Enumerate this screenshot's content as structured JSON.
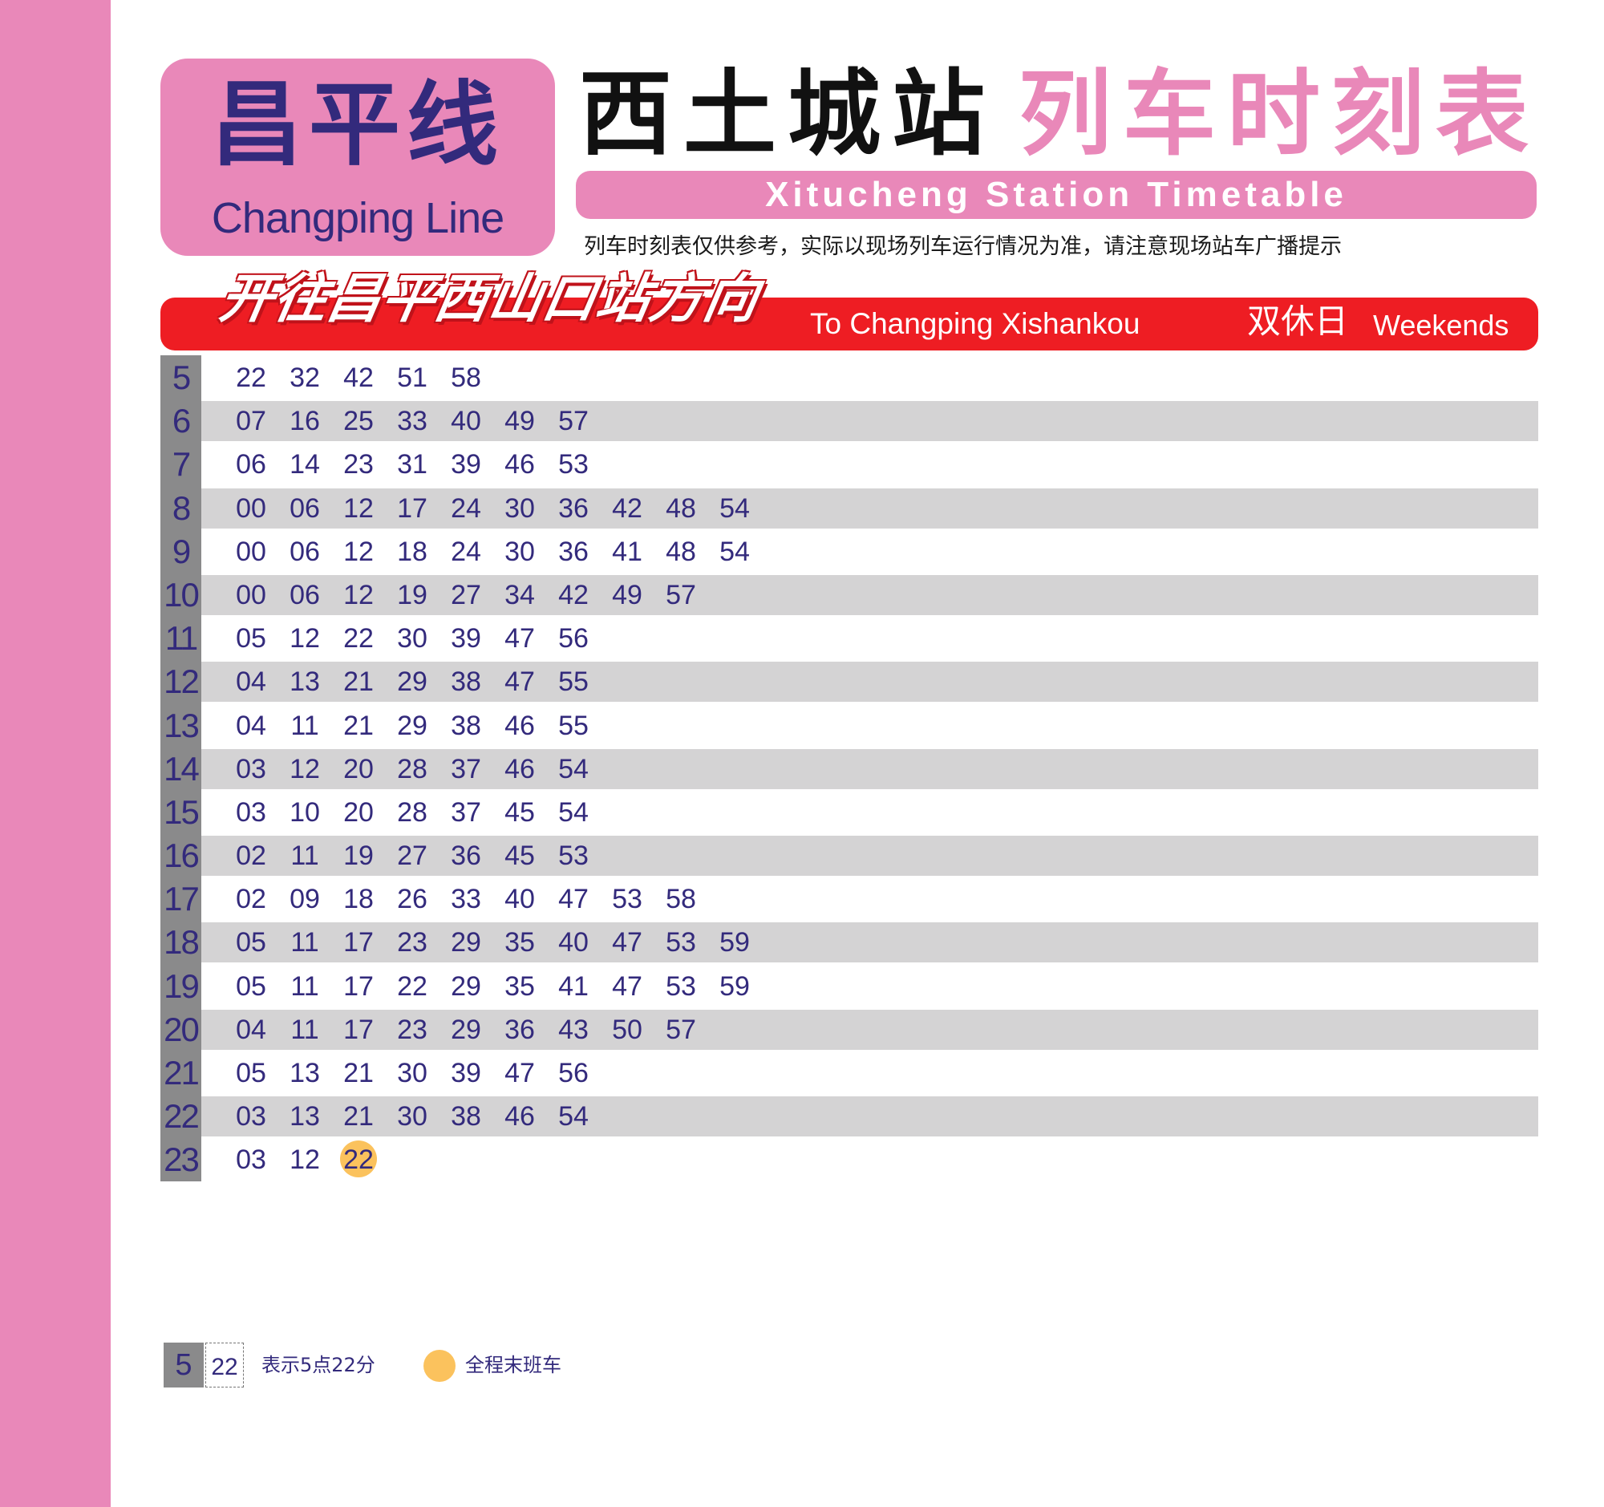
{
  "line": {
    "name_cn": "昌平线",
    "name_en": "Changping Line",
    "color": "#e988b9"
  },
  "header": {
    "station_cn": "西土城站",
    "title_cn": "列车时刻表",
    "subtitle_en": "Xitucheng Station Timetable",
    "notice": "列车时刻表仅供参考，实际以现场列车运行情况为准，请注意现场站车广播提示"
  },
  "direction": {
    "cn": "开往昌平西山口站方向",
    "en": "To Changping Xishankou",
    "day_cn": "双休日",
    "day_en": "Weekends",
    "bar_color": "#ee1d23"
  },
  "timetable": [
    {
      "hour": "5",
      "minutes": [
        "22",
        "32",
        "42",
        "51",
        "58"
      ]
    },
    {
      "hour": "6",
      "minutes": [
        "07",
        "16",
        "25",
        "33",
        "40",
        "49",
        "57"
      ]
    },
    {
      "hour": "7",
      "minutes": [
        "06",
        "14",
        "23",
        "31",
        "39",
        "46",
        "53"
      ]
    },
    {
      "hour": "8",
      "minutes": [
        "00",
        "06",
        "12",
        "17",
        "24",
        "30",
        "36",
        "42",
        "48",
        "54"
      ]
    },
    {
      "hour": "9",
      "minutes": [
        "00",
        "06",
        "12",
        "18",
        "24",
        "30",
        "36",
        "41",
        "48",
        "54"
      ]
    },
    {
      "hour": "10",
      "minutes": [
        "00",
        "06",
        "12",
        "19",
        "27",
        "34",
        "42",
        "49",
        "57"
      ]
    },
    {
      "hour": "11",
      "minutes": [
        "05",
        "12",
        "22",
        "30",
        "39",
        "47",
        "56"
      ]
    },
    {
      "hour": "12",
      "minutes": [
        "04",
        "13",
        "21",
        "29",
        "38",
        "47",
        "55"
      ]
    },
    {
      "hour": "13",
      "minutes": [
        "04",
        "11",
        "21",
        "29",
        "38",
        "46",
        "55"
      ]
    },
    {
      "hour": "14",
      "minutes": [
        "03",
        "12",
        "20",
        "28",
        "37",
        "46",
        "54"
      ]
    },
    {
      "hour": "15",
      "minutes": [
        "03",
        "10",
        "20",
        "28",
        "37",
        "45",
        "54"
      ]
    },
    {
      "hour": "16",
      "minutes": [
        "02",
        "11",
        "19",
        "27",
        "36",
        "45",
        "53"
      ]
    },
    {
      "hour": "17",
      "minutes": [
        "02",
        "09",
        "18",
        "26",
        "33",
        "40",
        "47",
        "53",
        "58"
      ]
    },
    {
      "hour": "18",
      "minutes": [
        "05",
        "11",
        "17",
        "23",
        "29",
        "35",
        "40",
        "47",
        "53",
        "59"
      ]
    },
    {
      "hour": "19",
      "minutes": [
        "05",
        "11",
        "17",
        "22",
        "29",
        "35",
        "41",
        "47",
        "53",
        "59"
      ]
    },
    {
      "hour": "20",
      "minutes": [
        "04",
        "11",
        "17",
        "23",
        "29",
        "36",
        "43",
        "50",
        "57"
      ]
    },
    {
      "hour": "21",
      "minutes": [
        "05",
        "13",
        "21",
        "30",
        "39",
        "47",
        "56"
      ]
    },
    {
      "hour": "22",
      "minutes": [
        "03",
        "13",
        "21",
        "30",
        "38",
        "46",
        "54"
      ]
    },
    {
      "hour": "23",
      "minutes": [
        "03",
        "12",
        "22"
      ],
      "last_train_index": 2
    }
  ],
  "legend": {
    "example_hour": "5",
    "example_minute": "22",
    "example_text": "表示5点22分",
    "last_train_text": "全程末班车",
    "last_train_color": "#fbc25d"
  }
}
